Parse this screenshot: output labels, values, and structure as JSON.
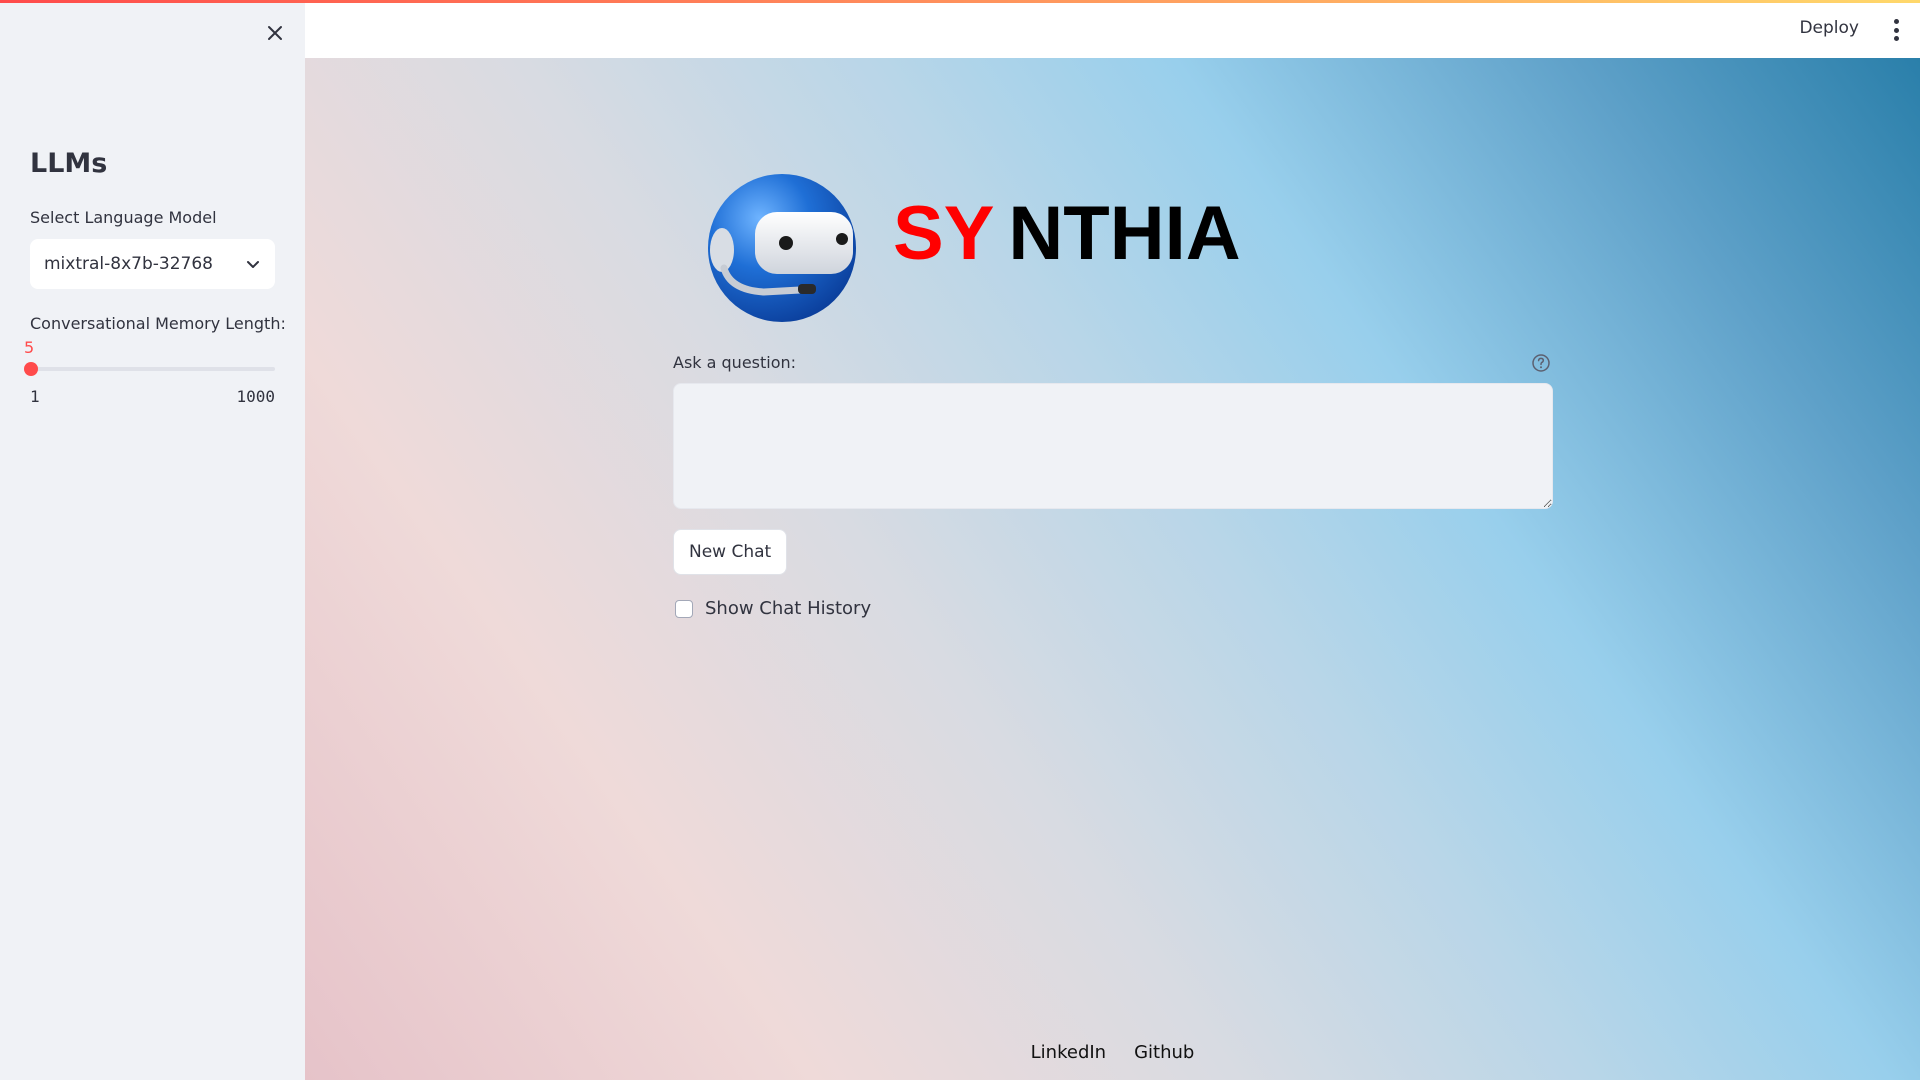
{
  "header": {
    "deploy_label": "Deploy"
  },
  "sidebar": {
    "title": "LLMs",
    "model_select": {
      "label": "Select Language Model",
      "value": "mixtral-8x7b-32768"
    },
    "memory_slider": {
      "label": "Conversational Memory Length:",
      "value": 5,
      "value_text": "5",
      "min": 1,
      "max": 1000,
      "min_text": "1",
      "max_text": "1000"
    }
  },
  "main": {
    "brand": {
      "part1": "SY",
      "part2": "NTHIA",
      "part1_color": "#ff0000",
      "part2_color": "#000000"
    },
    "question": {
      "label": "Ask a question:",
      "value": "",
      "placeholder": ""
    },
    "new_chat_label": "New Chat",
    "show_history": {
      "label": "Show Chat History",
      "checked": false
    }
  },
  "footer": {
    "links": [
      "LinkedIn",
      "Github"
    ]
  },
  "colors": {
    "accent": "#ff4b4b",
    "sidebar_bg": "#f0f2f6",
    "text": "#31333f"
  },
  "icons": [
    "close-icon",
    "chevron-down-icon",
    "help-icon",
    "more-vertical-icon",
    "bot-avatar-icon"
  ]
}
